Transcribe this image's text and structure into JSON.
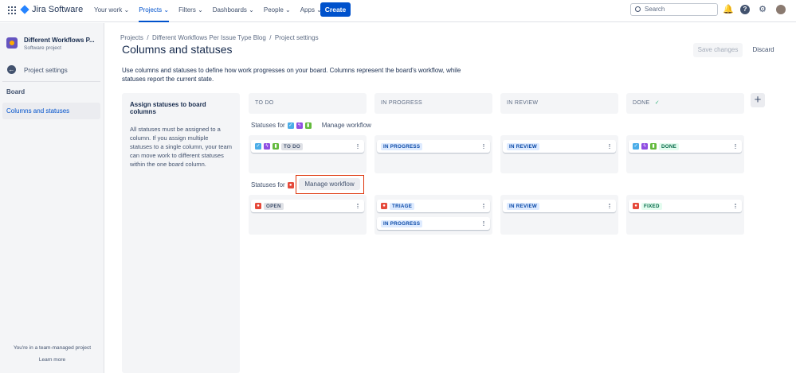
{
  "topbar": {
    "app_name": "Jira Software",
    "nav": [
      "Your work",
      "Projects",
      "Filters",
      "Dashboards",
      "People",
      "Apps"
    ],
    "active_nav": "Projects",
    "create_label": "Create",
    "search_placeholder": "Search"
  },
  "sidebar": {
    "project_name": "Different Workflows P...",
    "project_type": "Software project",
    "back_label": "Project settings",
    "section": "Board",
    "selected_item": "Columns and statuses",
    "footer_text": "You're in a team-managed project",
    "learn_more": "Learn more"
  },
  "breadcrumb": [
    "Projects",
    "Different Workflows Per Issue Type Blog",
    "Project settings"
  ],
  "page": {
    "title": "Columns and statuses",
    "save_label": "Save changes",
    "discard_label": "Discard",
    "description": "Use columns and statuses to define how work progresses on your board. Columns represent the board's workflow, while statuses report the current state."
  },
  "panel": {
    "title": "Assign statuses to board columns",
    "text": "All statuses must be assigned to a column. If you assign multiple statuses to a single column, your team can move work to different statuses within the one board column."
  },
  "columns": [
    "TO DO",
    "IN PROGRESS",
    "IN REVIEW",
    "DONE"
  ],
  "groups": [
    {
      "label": "Statuses for",
      "manage": "Manage workflow",
      "statuses": {
        "todo": "TO DO",
        "inprogress": "IN PROGRESS",
        "inreview": "IN REVIEW",
        "done": "DONE"
      }
    },
    {
      "label": "Statuses for",
      "manage": "Manage workflow",
      "statuses": {
        "todo": "OPEN",
        "inprogress": "TRIAGE",
        "inprogress2": "IN PROGRESS",
        "inreview": "IN REVIEW",
        "done": "FIXED"
      }
    }
  ],
  "colors": {
    "accent": "#0052cc",
    "highlight": "#de350b",
    "task": "#4bade8",
    "subtask": "#904ee2",
    "story": "#63ba3c",
    "bug": "#e5493a"
  }
}
